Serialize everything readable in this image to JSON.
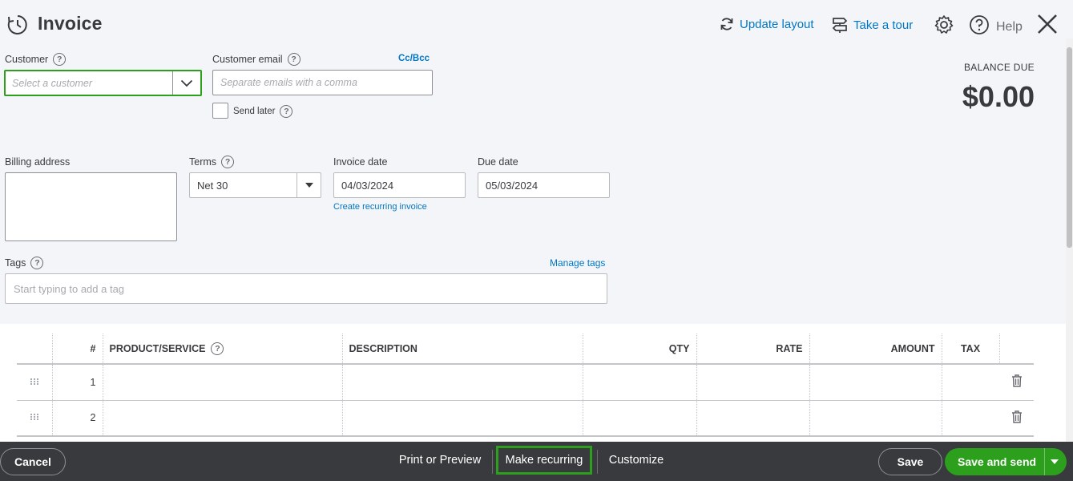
{
  "header": {
    "title": "Invoice",
    "update_layout": "Update layout",
    "take_tour": "Take a tour",
    "help": "Help"
  },
  "form": {
    "customer_label": "Customer",
    "customer_placeholder": "Select a customer",
    "email_label": "Customer email",
    "email_placeholder": "Separate emails with a comma",
    "cc_bcc": "Cc/Bcc",
    "send_later": "Send later",
    "billing_label": "Billing address",
    "terms_label": "Terms",
    "terms_value": "Net 30",
    "invoice_date_label": "Invoice date",
    "invoice_date": "04/03/2024",
    "due_date_label": "Due date",
    "due_date": "05/03/2024",
    "create_recurring": "Create recurring invoice",
    "tags_label": "Tags",
    "tags_placeholder": "Start typing to add a tag",
    "manage_tags": "Manage tags"
  },
  "balance": {
    "label": "BALANCE DUE",
    "value": "$0.00"
  },
  "table": {
    "columns": [
      "#",
      "PRODUCT/SERVICE",
      "DESCRIPTION",
      "QTY",
      "RATE",
      "AMOUNT",
      "TAX"
    ],
    "rows": [
      {
        "num": "1"
      },
      {
        "num": "2"
      }
    ]
  },
  "footer": {
    "cancel": "Cancel",
    "print_preview": "Print or Preview",
    "make_recurring": "Make recurring",
    "customize": "Customize",
    "save": "Save",
    "save_and_send": "Save and send"
  },
  "colors": {
    "accent_green": "#2ca01c",
    "link_blue": "#0077c5",
    "footer_bg": "#393a3d"
  }
}
